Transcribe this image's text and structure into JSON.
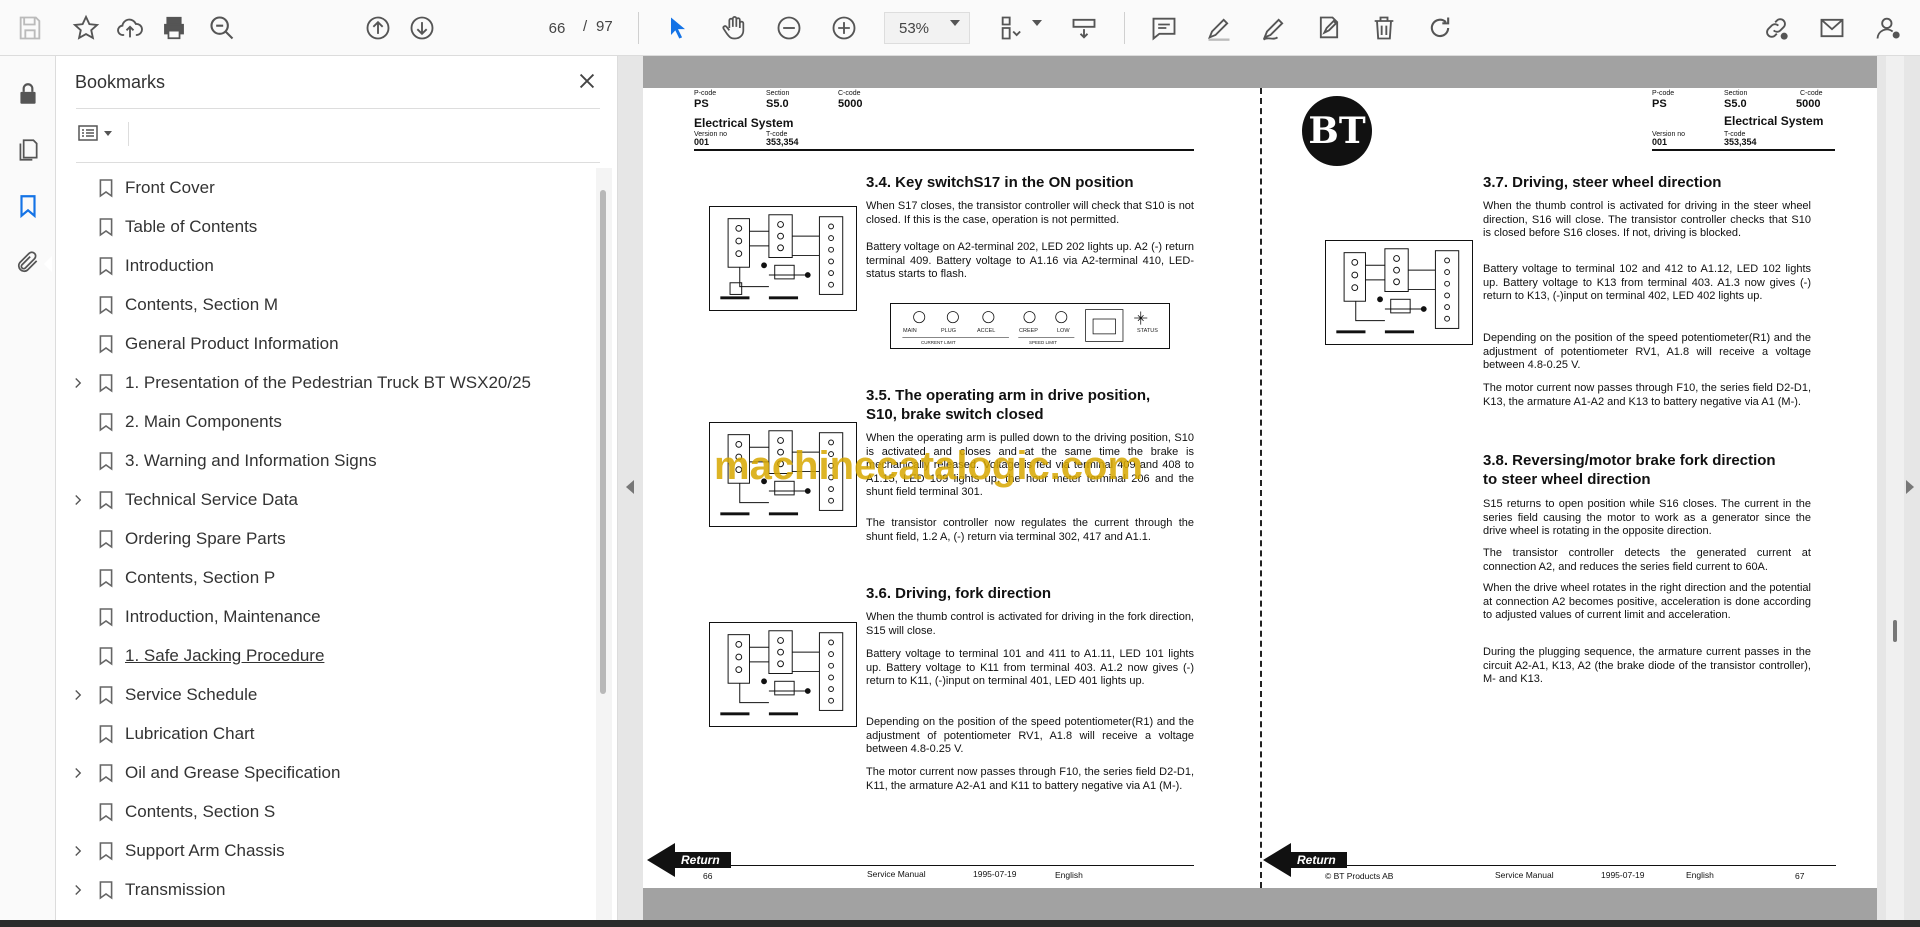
{
  "toolbar": {
    "page_current": "66",
    "page_separator": "/",
    "page_total": "97",
    "zoom": "53%"
  },
  "colors": {
    "accent": "#1473e6",
    "watermark": "#d8a800",
    "band": "#a2a2a2"
  },
  "bookmarks": {
    "title": "Bookmarks",
    "items": [
      {
        "label": "Front Cover",
        "expandable": false
      },
      {
        "label": "Table of Contents",
        "expandable": false
      },
      {
        "label": "Introduction",
        "expandable": false
      },
      {
        "label": "Contents, Section M",
        "expandable": false
      },
      {
        "label": "General Product Information",
        "expandable": false
      },
      {
        "label": "1.  Presentation of the Pedestrian Truck BT WSX20/25",
        "expandable": true
      },
      {
        "label": "2.  Main Components",
        "expandable": false
      },
      {
        "label": "3.  Warning and Information Signs",
        "expandable": false
      },
      {
        "label": "Technical Service Data",
        "expandable": true
      },
      {
        "label": "Ordering Spare Parts",
        "expandable": false
      },
      {
        "label": "Contents, Section P",
        "expandable": false
      },
      {
        "label": "Introduction, Maintenance",
        "expandable": false
      },
      {
        "label": "1.  Safe Jacking Procedure",
        "expandable": false,
        "active": true
      },
      {
        "label": "Service Schedule",
        "expandable": true
      },
      {
        "label": "Lubrication Chart",
        "expandable": false
      },
      {
        "label": "Oil and Grease Specification",
        "expandable": true
      },
      {
        "label": "Contents, Section S",
        "expandable": false
      },
      {
        "label": "Support Arm Chassis",
        "expandable": true
      },
      {
        "label": "Transmission",
        "expandable": true
      }
    ]
  },
  "watermark": "machinecatalogic.com",
  "left_page": {
    "header": {
      "pcode_label": "P-code",
      "pcode": "PS",
      "section_label": "Section",
      "section": "S5.0",
      "ccode_label": "C-code",
      "ccode": "5000",
      "title": "Electrical System",
      "version_label": "Version no",
      "version": "001",
      "tcode_label": "T-code",
      "tcode": "353,354"
    },
    "sections": [
      {
        "title": "3.4. Key switchS17 in the ON position",
        "paras": [
          "When S17 closes, the transistor controller will check that S10 is not closed. If this is the case, operation is not permitted.",
          "Battery voltage on A2-terminal 202, LED 202 lights up. A2 (-) return terminal 409. Battery voltage to A1.16 via A2-terminal 410, LED-status starts to flash."
        ]
      },
      {
        "title_line1": "3.5. The operating arm in drive position,",
        "title_line2": "S10, brake switch closed",
        "paras": [
          "When the operating arm is pulled down to the driving position, S10 is activated and closes and at the same time the brake is mechanically released. Voltage is fed via terminal 409 and 408 to A1.15, LED 109 lights up, the hour meter terminal 206 and the shunt field terminal 301.",
          "The transistor controller now regulates the current through the shunt field, 1.2 A, (-) return via terminal 302, 417 and A1.1."
        ]
      },
      {
        "title": "3.6. Driving, fork direction",
        "paras": [
          "When the thumb control is activated for driving in the fork direction, S15 will close.",
          "Battery voltage to terminal 101 and 411 to A1.11, LED 101 lights up. Battery voltage to K11 from terminal 403. A1.2 now gives (-) return to K11, (-)input on terminal 401, LED 401 lights up.",
          "Depending on the position of the speed potentiometer(R1) and the adjustment of potentiometer RV1, A1.8 will receive a voltage between 4.8-0.25 V.",
          "The motor current now passes through F10, the series field D2-D1, K11, the armature A2-A1 and K11 to battery negative via A1 (M-)."
        ]
      }
    ],
    "panel_labels": {
      "off": "OFF",
      "main": "MAIN",
      "plug": "PLUG",
      "accel": "ACCEL",
      "creep": "CREEP",
      "low": "LOW",
      "status": "STATUS",
      "current_limit": "CURRENT LIMIT",
      "speed_limit": "SPEED LIMIT"
    },
    "footer": {
      "return": "Return",
      "page_no": "66",
      "manual": "Service Manual",
      "date": "1995-07-19",
      "lang": "English"
    }
  },
  "right_page": {
    "header": {
      "pcode_label": "P-code",
      "pcode": "PS",
      "section_label": "Section",
      "section": "S5.0",
      "ccode_label": "C-code",
      "ccode": "5000",
      "title": "Electrical System",
      "version_label": "Version no",
      "version": "001",
      "tcode_label": "T-code",
      "tcode": "353,354"
    },
    "logo_text": "BT",
    "sections": [
      {
        "title": "3.7. Driving, steer wheel direction",
        "paras": [
          "When the thumb control is activated for driving in the steer wheel direction, S16 will close. The transistor controller checks that S10 is closed before S16 closes. If not, driving is blocked.",
          "Battery voltage to terminal 102 and 412 to A1.12, LED 102 lights up. Battery voltage to K13 from terminal 403. A1.3 now gives (-) return to K13, (-)input on terminal 402, LED 402 lights up.",
          "Depending on the position of the speed potentiometer(R1) and the adjustment of potentiometer RV1, A1.8 will receive a voltage between 4.8-0.25 V.",
          "The motor current now passes through F10, the series field D2-D1, K13, the armature A1-A2 and K13 to battery negative via A1 (M-)."
        ]
      },
      {
        "title_line1": "3.8. Reversing/motor brake fork direction",
        "title_line2": "to steer wheel direction",
        "paras": [
          "S15 returns to open position while S16 closes. The current in the series field causing the motor to work as a generator since the drive wheel is rotating in the opposite direction.",
          "The transistor controller detects the generated current at connection A2, and reduces the series field current to 60A.",
          "When the drive wheel rotates in the right direction and the potential at connection A2 becomes positive, acceleration is done according to adjusted values of current limit and acceleration.",
          "During the plugging sequence, the armature current passes in the circuit A2-A1, K13, A2 (the brake diode of the transistor controller), M- and K13."
        ]
      }
    ],
    "footer": {
      "return": "Return",
      "company": "© BT Products AB",
      "manual": "Service Manual",
      "date": "1995-07-19",
      "lang": "English",
      "page_no": "67"
    }
  }
}
